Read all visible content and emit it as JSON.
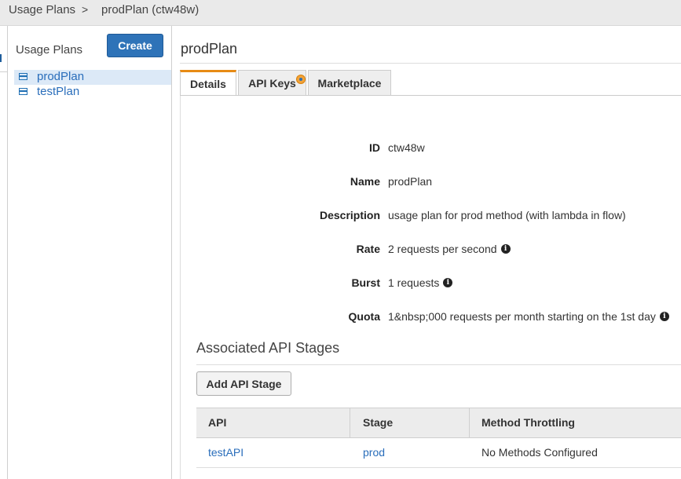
{
  "breadcrumb": {
    "root": "Usage Plans",
    "separator": ">",
    "current": "prodPlan (ctw48w)"
  },
  "sidebar": {
    "title": "Usage Plans",
    "create_label": "Create",
    "items": [
      {
        "label": "prodPlan",
        "selected": true
      },
      {
        "label": "testPlan",
        "selected": false
      }
    ]
  },
  "main": {
    "title": "prodPlan",
    "tabs": [
      {
        "label": "Details",
        "active": true
      },
      {
        "label": "API Keys",
        "active": false
      },
      {
        "label": "Marketplace",
        "active": false
      }
    ],
    "details": {
      "id_label": "ID",
      "id_value": "ctw48w",
      "name_label": "Name",
      "name_value": "prodPlan",
      "description_label": "Description",
      "description_value": "usage plan for prod method (with lambda in flow)",
      "rate_label": "Rate",
      "rate_value": "2 requests per second",
      "burst_label": "Burst",
      "burst_value": "1 requests",
      "quota_label": "Quota",
      "quota_value": "1&nbsp;000 requests per month starting on the 1st day"
    },
    "stages": {
      "title": "Associated API Stages",
      "add_label": "Add API Stage",
      "columns": [
        "API",
        "Stage",
        "Method Throttling"
      ],
      "rows": [
        {
          "api": "testAPI",
          "stage": "prod",
          "throttling": "No Methods Configured"
        }
      ]
    }
  },
  "colors": {
    "accent": "#2e73b8",
    "link": "#2a6ebb",
    "active_tab": "#e78b15",
    "selected_row": "#dce9f7"
  },
  "icons": {
    "plan_item": "usage-plan-icon",
    "info": "info-icon",
    "tab_badge": "notification-dot-icon"
  }
}
